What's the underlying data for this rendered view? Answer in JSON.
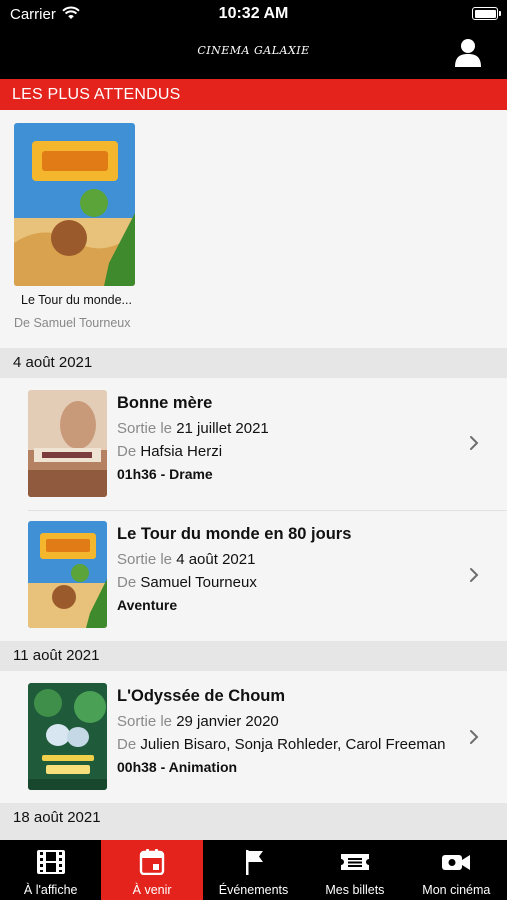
{
  "status_bar": {
    "carrier": "Carrier",
    "time": "10:32 AM"
  },
  "header": {
    "logo": "CINEMA GALAXIE"
  },
  "section": {
    "title": "LES PLUS ATTENDUS"
  },
  "featured": {
    "title": "Le Tour du monde...",
    "director": "De Samuel Tourneux"
  },
  "groups": [
    {
      "date": "4 août 2021",
      "movies": [
        {
          "title": "Bonne mère",
          "release_prefix": "Sortie le",
          "release_date": "21 juillet 2021",
          "director_prefix": "De",
          "director": "Hafsia Herzi",
          "meta": "01h36 - Drame"
        },
        {
          "title": "Le Tour du monde en 80 jours",
          "release_prefix": "Sortie le",
          "release_date": "4 août 2021",
          "director_prefix": "De",
          "director": "Samuel Tourneux",
          "meta": "Aventure"
        }
      ]
    },
    {
      "date": "11 août 2021",
      "movies": [
        {
          "title": "L'Odyssée de Choum",
          "release_prefix": "Sortie le",
          "release_date": "29 janvier 2020",
          "director_prefix": "De",
          "director": "Julien Bisaro, Sonja Rohleder, Carol Freeman",
          "meta": "00h38 - Animation"
        }
      ]
    },
    {
      "date": "18 août 2021",
      "movies": []
    }
  ],
  "tabs": [
    {
      "label": "À l'affiche",
      "icon": "film-icon"
    },
    {
      "label": "À venir",
      "icon": "calendar-icon"
    },
    {
      "label": "Événements",
      "icon": "flag-icon"
    },
    {
      "label": "Mes billets",
      "icon": "ticket-icon"
    },
    {
      "label": "Mon cinéma",
      "icon": "camera-icon"
    }
  ],
  "colors": {
    "accent": "#e3231c",
    "header_bg": "#000000",
    "date_bg": "#e6e6e6",
    "muted_text": "#8a8a8a"
  }
}
